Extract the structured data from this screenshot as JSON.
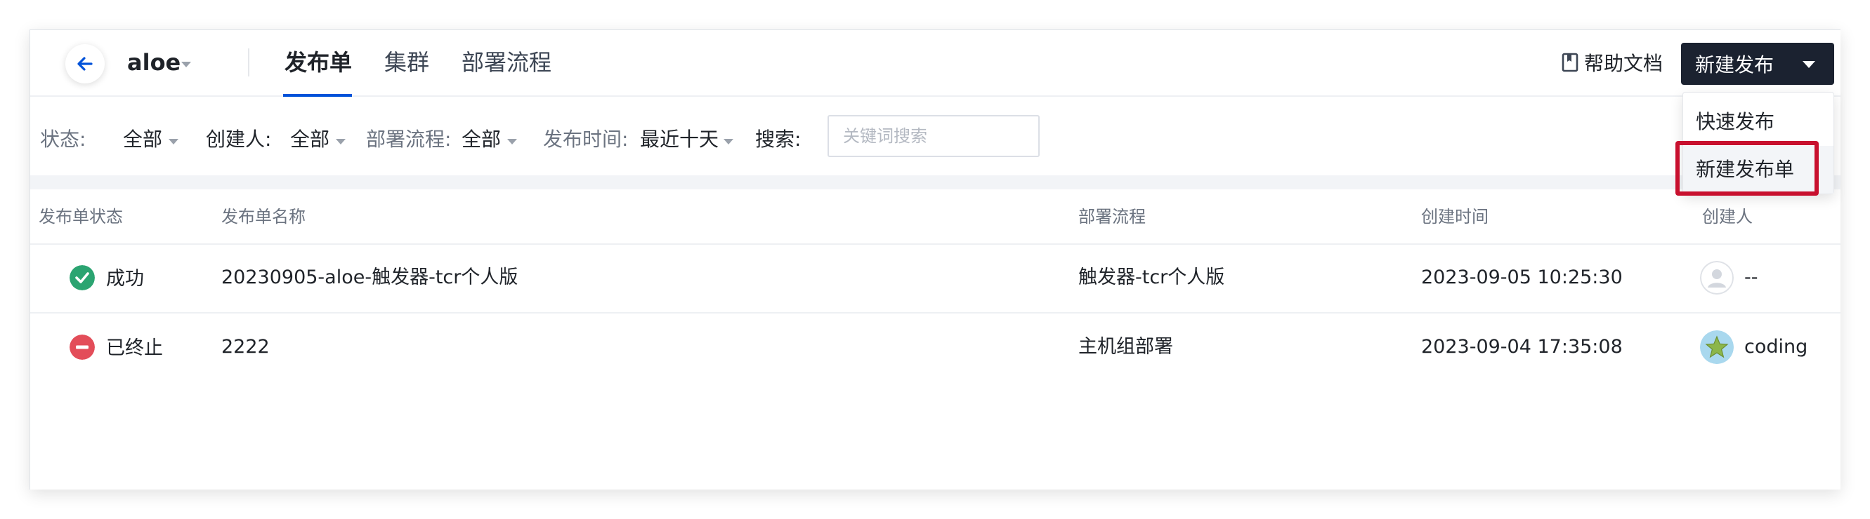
{
  "header": {
    "project_name": "aloe",
    "tabs": [
      {
        "label": "发布单",
        "active": true
      },
      {
        "label": "集群",
        "active": false
      },
      {
        "label": "部署流程",
        "active": false
      }
    ],
    "help_label": "帮助文档",
    "new_release_label": "新建发布"
  },
  "dropdown": {
    "items": [
      {
        "label": "快速发布"
      },
      {
        "label": "新建发布单"
      }
    ]
  },
  "filters": {
    "status_label": "状态:",
    "status_value": "全部",
    "creator_label": "创建人:",
    "creator_value": "全部",
    "flow_label": "部署流程:",
    "flow_value": "全部",
    "time_label": "发布时间:",
    "time_value": "最近十天",
    "search_label": "搜索:",
    "search_placeholder": "关键词搜索"
  },
  "table": {
    "columns": [
      "发布单状态",
      "发布单名称",
      "部署流程",
      "创建时间",
      "创建人"
    ],
    "rows": [
      {
        "status": "成功",
        "status_type": "success",
        "name": "20230905-aloe-触发器-tcr个人版",
        "flow": "触发器-tcr个人版",
        "created": "2023-09-05 10:25:30",
        "creator": "--",
        "avatar": "default-avatar-icon"
      },
      {
        "status": "已终止",
        "status_type": "stopped",
        "name": "2222",
        "flow": "主机组部署",
        "created": "2023-09-04 17:35:08",
        "creator": "coding",
        "avatar": "star-avatar-icon"
      }
    ]
  },
  "colors": {
    "primary": "#0052d9",
    "dark_button": "#1b2230",
    "success": "#2ba471",
    "stopped": "#e34d59",
    "highlight": "#c8102e"
  }
}
